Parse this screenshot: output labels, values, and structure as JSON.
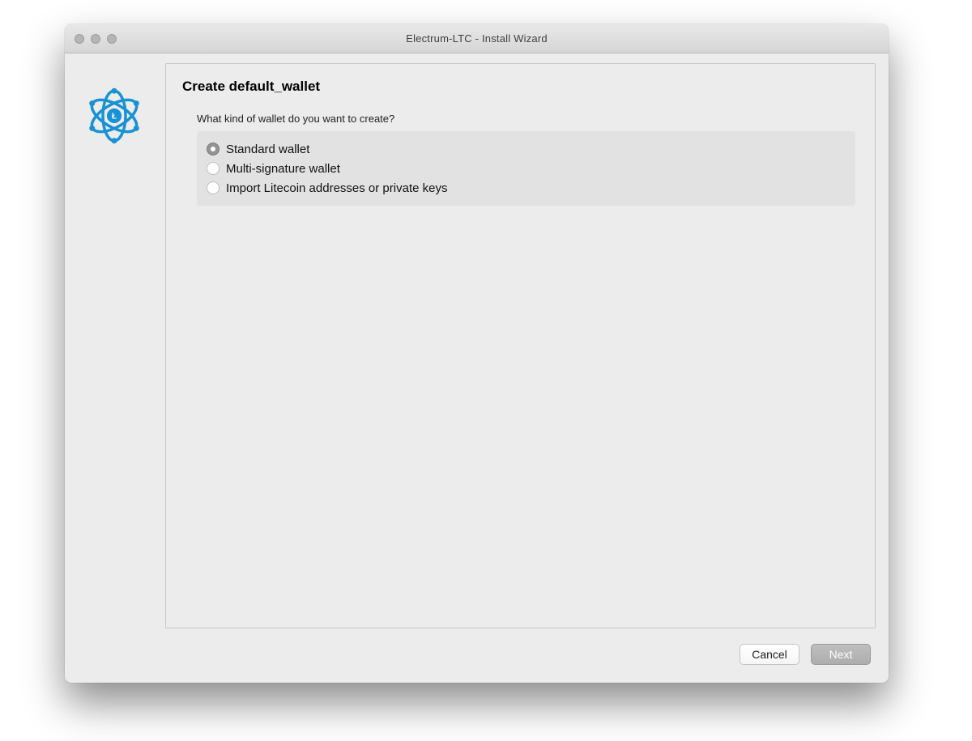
{
  "window": {
    "title": "Electrum-LTC  -  Install Wizard"
  },
  "content": {
    "heading": "Create default_wallet",
    "prompt": "What kind of wallet do you want to create?",
    "options": [
      {
        "label": "Standard wallet",
        "selected": true
      },
      {
        "label": "Multi-signature wallet",
        "selected": false
      },
      {
        "label": "Import Litecoin addresses or private keys",
        "selected": false
      }
    ]
  },
  "footer": {
    "cancel": "Cancel",
    "next": "Next"
  },
  "logo": {
    "name": "electrum-ltc-logo",
    "accent": "#1991d5"
  }
}
